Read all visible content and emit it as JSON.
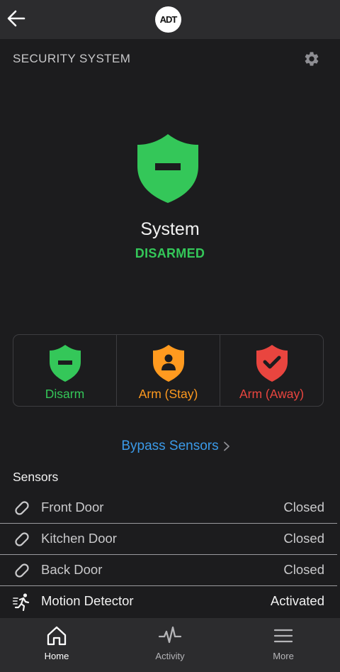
{
  "colors": {
    "green": "#34c759",
    "orange": "#ff9a1f",
    "red": "#e9453f",
    "link_blue": "#3b9ae8",
    "background": "#1c1c1e",
    "bar": "#2c2c2e"
  },
  "topbar": {
    "back_icon": "arrow-left-icon",
    "logo_text": "ADT"
  },
  "header": {
    "title": "SECURITY SYSTEM",
    "settings_icon": "gear-icon"
  },
  "status": {
    "icon": "shield-minus-icon",
    "label": "System",
    "value": "DISARMED"
  },
  "modes": [
    {
      "label": "Disarm",
      "icon": "shield-minus-icon",
      "color": "#34c759"
    },
    {
      "label": "Arm (Stay)",
      "icon": "shield-person-icon",
      "color": "#ff9a1f"
    },
    {
      "label": "Arm (Away)",
      "icon": "shield-check-icon",
      "color": "#e9453f"
    }
  ],
  "bypass": {
    "label": "Bypass Sensors",
    "icon": "chevron-right-icon"
  },
  "sensors": {
    "heading": "Sensors",
    "items": [
      {
        "name": "Front Door",
        "state": "Closed",
        "icon": "door-sensor-icon"
      },
      {
        "name": "Kitchen Door",
        "state": "Closed",
        "icon": "door-sensor-icon"
      },
      {
        "name": "Back Door",
        "state": "Closed",
        "icon": "door-sensor-icon"
      },
      {
        "name": "Motion Detector",
        "state": "Activated",
        "icon": "running-person-icon"
      }
    ]
  },
  "nav": {
    "items": [
      {
        "label": "Home",
        "icon": "home-icon",
        "active": true
      },
      {
        "label": "Activity",
        "icon": "activity-icon",
        "active": false
      },
      {
        "label": "More",
        "icon": "menu-icon",
        "active": false
      }
    ]
  }
}
